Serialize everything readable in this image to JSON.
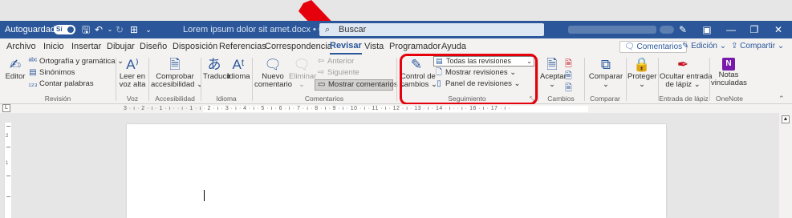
{
  "titlebar": {
    "autosave_label": "Autoguardado",
    "autosave_state": "Sí",
    "doc_title": "Lorem ipsum dolor sit amet.docx • Guardado",
    "search_placeholder": "Buscar"
  },
  "tabs": [
    "Archivo",
    "Inicio",
    "Insertar",
    "Dibujar",
    "Diseño",
    "Disposición",
    "Referencias",
    "Correspondencia",
    "Revisar",
    "Vista",
    "Programador",
    "Ayuda"
  ],
  "active_tab": "Revisar",
  "right_actions": {
    "comments": "Comentarios",
    "editing": "Edición",
    "share": "Compartir"
  },
  "ribbon": {
    "revision": {
      "editor": "Editor",
      "spelling": "Ortografía y gramática",
      "synonyms": "Sinónimos",
      "word_count": "Contar palabras",
      "label": "Revisión"
    },
    "voice": {
      "read_l1": "Leer en",
      "read_l2": "voz alta",
      "label": "Voz"
    },
    "accessibility": {
      "check_l1": "Comprobar",
      "check_l2": "accesibilidad",
      "label": "Accesibilidad"
    },
    "language": {
      "translate": "Traducir",
      "language": "Idioma",
      "label": "Idioma"
    },
    "comments": {
      "new_l1": "Nuevo",
      "new_l2": "comentario",
      "delete": "Eliminar",
      "previous": "Anterior",
      "next": "Siguiente",
      "show_comments": "Mostrar comentarios",
      "label": "Comentarios"
    },
    "tracking": {
      "track_l1": "Control de",
      "track_l2": "cambios",
      "markup_select": "Todas las revisiones",
      "show_markup": "Mostrar revisiones",
      "reviewing_pane": "Panel de revisiones",
      "label": "Seguimiento"
    },
    "changes": {
      "accept": "Aceptar",
      "label": "Cambios"
    },
    "compare": {
      "compare": "Comparar",
      "label": "Comparar"
    },
    "protect": {
      "protect": "Proteger"
    },
    "ink": {
      "hide_l1": "Ocultar entrada",
      "hide_l2": "de lápiz",
      "label": "Entrada de lápiz"
    },
    "onenote": {
      "notes_l1": "Notas",
      "notes_l2": "vinculadas",
      "label": "OneNote"
    }
  },
  "ruler": {
    "text": "3 · ı · 2 · ı · 1 · ı ·   · ı · 1 · ı · 2 · ı · 3 · ı · 4 · ı · 5 · ı · 6 · ı · 7 · ı · 8 · ı · 9 · ı · 10 · ı · 11 · ı · 12 · ı · 13 · ı · 14 · ı ·   · ı · 16 · ı · 17 · ı ·",
    "corner": "L"
  },
  "vruler": {
    "marks": [
      "2",
      "1"
    ]
  },
  "colors": {
    "titlebar": "#2b579a",
    "highlight": "#e6000c",
    "arrow": "#e6000c"
  }
}
